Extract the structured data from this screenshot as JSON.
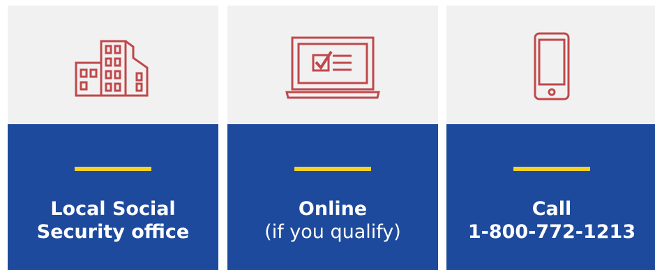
{
  "colors": {
    "card_top": "#f1f1f2",
    "card_bottom": "#1d4a9c",
    "accent": "#f6d31f",
    "icon": "#c0484a",
    "text": "#ffffff"
  },
  "cards": [
    {
      "icon": "office-building-icon",
      "line1": "Local Social",
      "line2": "Security office"
    },
    {
      "icon": "laptop-checklist-icon",
      "line1": "Online",
      "line2": "(if you qualify)"
    },
    {
      "icon": "smartphone-icon",
      "line1": "Call",
      "line2": "1-800-772-1213"
    }
  ]
}
